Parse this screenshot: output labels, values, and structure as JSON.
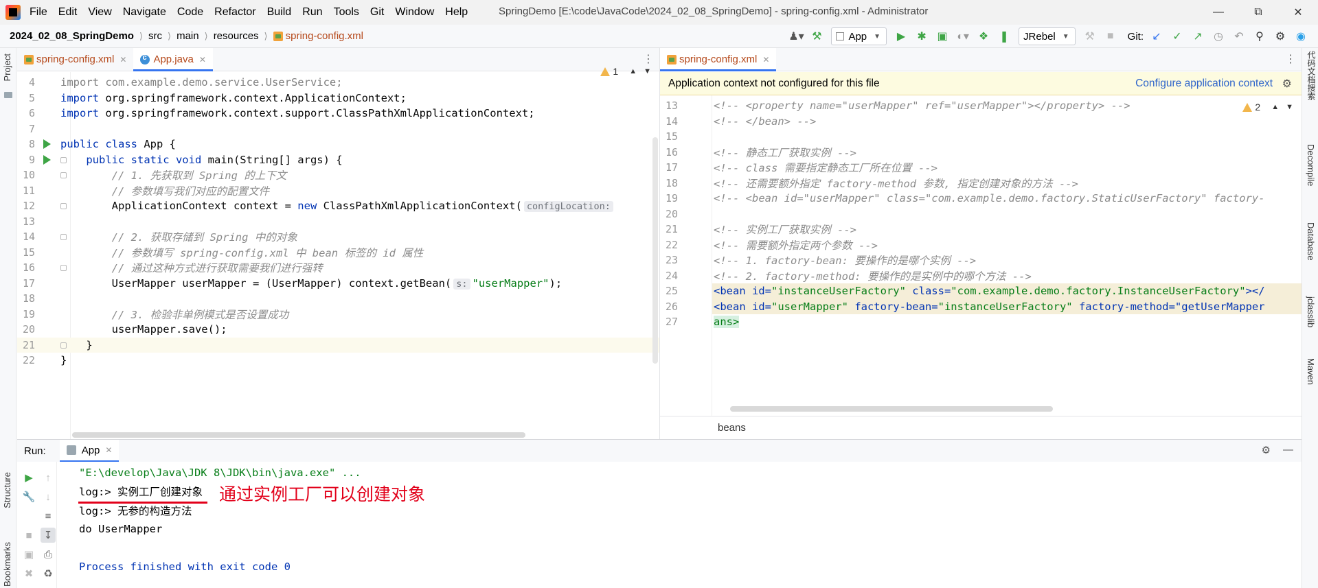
{
  "menu": [
    "File",
    "Edit",
    "View",
    "Navigate",
    "Code",
    "Refactor",
    "Build",
    "Run",
    "Tools",
    "Git",
    "Window",
    "Help"
  ],
  "window_title": "SpringDemo [E:\\code\\JavaCode\\2024_02_08_SpringDemo] - spring-config.xml - Administrator",
  "breadcrumb": [
    "2024_02_08_SpringDemo",
    "src",
    "main",
    "resources",
    "spring-config.xml"
  ],
  "toolbar": {
    "run_config": "App",
    "jrebel": "JRebel",
    "git_label": "Git:"
  },
  "left_strip": {
    "project": "Project",
    "structure": "Structure",
    "bookmarks": "Bookmarks"
  },
  "right_strip": {
    "code_search": "代码文档搜索",
    "decompile": "Decompile",
    "database": "Database",
    "jclasslib": "jclasslib",
    "maven": "Maven"
  },
  "left_editor": {
    "tabs": [
      {
        "label": "spring-config.xml",
        "active": false
      },
      {
        "label": "App.java",
        "active": true
      }
    ],
    "warnings": "1",
    "lines": [
      {
        "n": "4",
        "text": "import com.example.demo.service.UserService;"
      },
      {
        "n": "5",
        "kw": "import",
        "text": " org.springframework.context.ApplicationContext;"
      },
      {
        "n": "6",
        "kw": "import",
        "text": " org.springframework.context.support.ClassPathXmlApplicationContext;"
      },
      {
        "n": "7",
        "text": ""
      },
      {
        "n": "8",
        "kw": "public class",
        "text": " App {"
      },
      {
        "n": "9",
        "kw": "    public static void",
        "text": " main(String[] args) {"
      },
      {
        "n": "10",
        "comment": "        // 1. 先获取到 Spring 的上下文"
      },
      {
        "n": "11",
        "comment": "        // 参数填写我们对应的配置文件"
      },
      {
        "n": "12",
        "text": "        ApplicationContext context = ",
        "kw2": "new",
        "text2": " ClassPathXmlApplicationContext(",
        "hint": "configLocation:"
      },
      {
        "n": "13",
        "text": ""
      },
      {
        "n": "14",
        "comment": "        // 2. 获取存储到 Spring 中的对象"
      },
      {
        "n": "15",
        "comment": "        // 参数填写 spring-config.xml 中 bean 标签的 id 属性"
      },
      {
        "n": "16",
        "comment": "        // 通过这种方式进行获取需要我们进行强转"
      },
      {
        "n": "17",
        "text": "        UserMapper userMapper = (UserMapper) context.getBean(",
        "hint": "s:",
        "str": "\"userMapper\"",
        "tail": ");"
      },
      {
        "n": "18",
        "text": ""
      },
      {
        "n": "19",
        "comment": "        // 3. 检验非单例模式是否设置成功"
      },
      {
        "n": "20",
        "text": "        userMapper.save();"
      },
      {
        "n": "21",
        "text": "    }"
      },
      {
        "n": "22",
        "text": "}"
      }
    ]
  },
  "right_editor": {
    "tabs": [
      {
        "label": "spring-config.xml",
        "active": true
      }
    ],
    "banner": "Application context not configured for this file",
    "banner_link": "Configure application context",
    "warnings": "2",
    "lines": [
      {
        "n": "13",
        "comment": "<!-- <property name=\"userMapper\" ref=\"userMapper\"></property> -->"
      },
      {
        "n": "14",
        "comment": "<!-- </bean> -->"
      },
      {
        "n": "15",
        "comment": ""
      },
      {
        "n": "16",
        "comment": "<!-- 静态工厂获取实例 -->"
      },
      {
        "n": "17",
        "comment": "<!-- class 需要指定静态工厂所在位置 -->"
      },
      {
        "n": "18",
        "comment": "<!-- 还需要额外指定 factory-method 参数, 指定创建对象的方法 -->"
      },
      {
        "n": "19",
        "comment": "<!-- <bean id=\"userMapper\" class=\"com.example.demo.factory.StaticUserFactory\" factory-"
      },
      {
        "n": "20",
        "comment": ""
      },
      {
        "n": "21",
        "comment": "<!-- 实例工厂获取实例 -->"
      },
      {
        "n": "22",
        "comment": "<!-- 需要额外指定两个参数 -->"
      },
      {
        "n": "23",
        "comment": "<!-- 1. factory-bean: 要操作的是哪个实例 -->"
      },
      {
        "n": "24",
        "comment": "<!-- 2. factory-method: 要操作的是实例中的哪个方法 -->"
      },
      {
        "n": "25",
        "xml": "<bean id=\"instanceUserFactory\" class=\"com.example.demo.factory.InstanceUserFactory\"></"
      },
      {
        "n": "26",
        "xml": "<bean id=\"userMapper\" factory-bean=\"instanceUserFactory\" factory-method=\"getUserMapper"
      },
      {
        "n": "27",
        "xml": "ans>"
      }
    ],
    "footer": "beans"
  },
  "run_panel": {
    "title": "Run:",
    "tab": "App",
    "console": {
      "cmd": "\"E:\\develop\\Java\\JDK 8\\JDK\\bin\\java.exe\" ...",
      "line1": "log:> 实例工厂创建对象",
      "line2": "log:> 无参的构造方法",
      "line3": "do UserMapper",
      "line4": "",
      "exit": "Process finished with exit code 0"
    },
    "annotation": "通过实例工厂可以创建对象"
  },
  "colors": {
    "accent": "#3574f0",
    "annotation": "#e2001a",
    "string": "#067d17",
    "keyword": "#0033b3",
    "comment": "#8c8c8c"
  }
}
